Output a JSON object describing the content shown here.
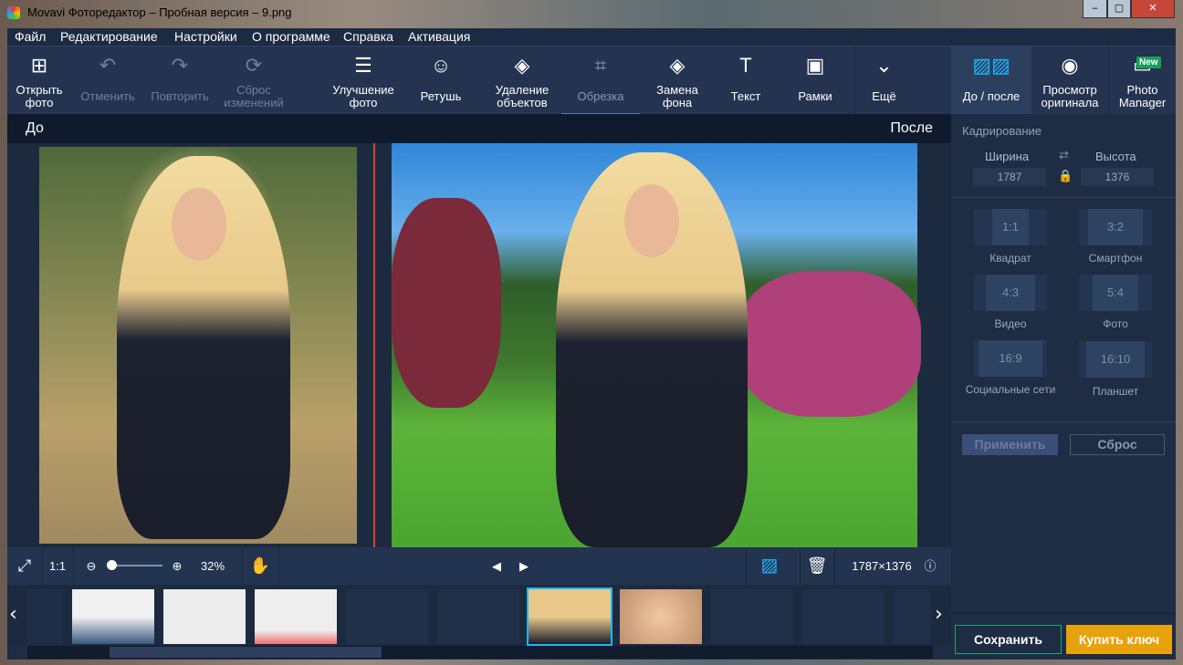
{
  "window": {
    "title": "Movavi Фоторедактор – Пробная версия – 9.png",
    "controls": [
      "minimize",
      "maximize",
      "close"
    ]
  },
  "menu": [
    "Файл",
    "Редактирование",
    "Настройки",
    "О программе",
    "Справка",
    "Активация"
  ],
  "toolbar": {
    "open": "Открыть фото",
    "undo": "Отменить",
    "redo": "Повторить",
    "reset": "Сброс изменений",
    "enhance": "Улучшение фото",
    "retouch": "Ретушь",
    "remove": "Удаление объектов",
    "crop": "Обрезка",
    "background": "Замена фона",
    "text": "Текст",
    "frames": "Рамки",
    "more": "Ещё",
    "before_after": "До / после",
    "view_original": "Просмотр оригинала",
    "photo_manager": "Photo Manager",
    "new_badge": "New"
  },
  "compare": {
    "before": "До",
    "after": "После"
  },
  "crop_panel": {
    "title": "Кадрирование",
    "width_label": "Ширина",
    "height_label": "Высота",
    "width": "1787",
    "height": "1376",
    "presets": [
      {
        "ratio": "1:1",
        "name": "Квадрат"
      },
      {
        "ratio": "3:2",
        "name": "Смартфон"
      },
      {
        "ratio": "4:3",
        "name": "Видео"
      },
      {
        "ratio": "5:4",
        "name": "Фото"
      },
      {
        "ratio": "16:9",
        "name": "Социальные сети"
      },
      {
        "ratio": "16:10",
        "name": "Планшет"
      }
    ],
    "apply": "Применить",
    "reset": "Сброс"
  },
  "bottombar": {
    "fit": "1:1",
    "zoom": "32%",
    "dimensions": "1787×1376"
  },
  "filmstrip": {
    "selected_index": 6,
    "count": 10
  },
  "actions": {
    "save": "Сохранить",
    "buy": "Купить ключ"
  },
  "colors": {
    "accent": "#1fb6ff",
    "buy": "#e8a20c",
    "save_border": "#1ea86a",
    "divider": "#d9403a"
  }
}
